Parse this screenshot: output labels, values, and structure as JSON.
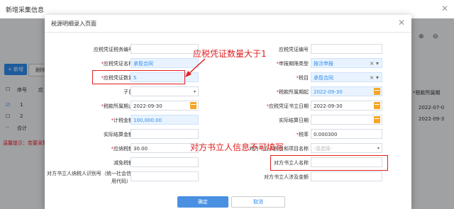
{
  "app": {
    "title": "新增采集信息",
    "toolbar": {
      "new_label": "新增",
      "delete_label": "删除"
    },
    "table": {
      "col_seq": "序号",
      "col_other": "应",
      "rows": [
        {
          "seq": "1"
        },
        {
          "seq": "2"
        }
      ],
      "total_label": "合计"
    },
    "warning": "温馨提示：若要采集",
    "right": {
      "header": "*税款所属期",
      "dates": [
        "2022-07-0",
        "2022-09-3"
      ]
    }
  },
  "dialog": {
    "title": "税源明细录入页面",
    "fields": {
      "voucher_tax_no": {
        "label": "应税凭证税务编号",
        "value": ""
      },
      "voucher_no": {
        "label": "应税凭证编号",
        "value": ""
      },
      "voucher_name": {
        "label": "应税凭证名称",
        "value": "承揽合同"
      },
      "report_type": {
        "label": "申报期限类型",
        "value": "按次申报"
      },
      "voucher_qty": {
        "label": "应税凭证数量",
        "value": "5"
      },
      "tax_item": {
        "label": "税目",
        "value": "承揽合同"
      },
      "sub_item": {
        "label": "子目",
        "value": ""
      },
      "period_start": {
        "label": "税款所属期起",
        "value": "2022-09-30"
      },
      "period_end": {
        "label": "税款所属期止",
        "value": "2022-09-30"
      },
      "sign_date": {
        "label": "应税凭证书立日期",
        "value": "2022-09-30"
      },
      "tax_amount": {
        "label": "计税金额",
        "value": "100,000.00"
      },
      "settle_date": {
        "label": "实际结算日期",
        "value": ""
      },
      "settle_amount": {
        "label": "实际结算金额",
        "value": ""
      },
      "tax_rate": {
        "label": "税率",
        "value": "0.000300"
      },
      "tax_payable": {
        "label": "应纳税额",
        "value": "30.00"
      },
      "cp_item_name": {
        "label": "对方书立人税目和项目名称",
        "value": "-请选择-"
      },
      "tax_reduction": {
        "label": "减免税额",
        "value": ""
      },
      "cp_name": {
        "label": "对方书立人名称",
        "value": ""
      },
      "cp_taxpayer_id": {
        "label": "对方书立人纳税人识别号（统一社会信用代码）",
        "value": ""
      },
      "cp_amount": {
        "label": "对方书立人涉及金额",
        "value": ""
      }
    },
    "annotations": {
      "qty_note": "应税凭证数量大于1",
      "cp_note": "对方书立人信息不可填写"
    },
    "buttons": {
      "ok": "确定",
      "cancel": "取消"
    }
  },
  "colors": {
    "accent": "#2d8cf0",
    "required": "#e02020",
    "calendar": "#f6a623"
  }
}
